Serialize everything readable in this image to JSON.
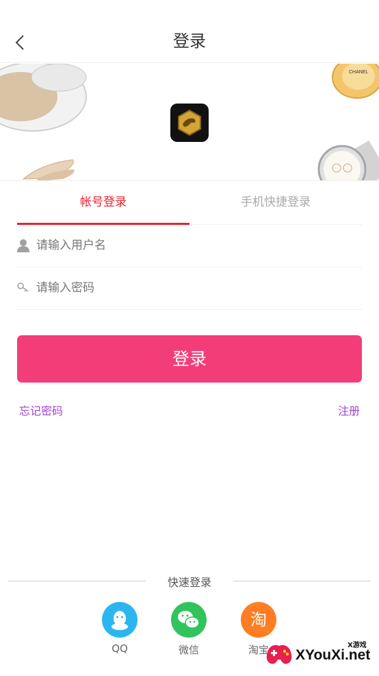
{
  "header": {
    "title": "登录"
  },
  "tabs": {
    "account": "帐号登录",
    "phone": "手机快捷登录"
  },
  "form": {
    "username_placeholder": "请输入用户名",
    "password_placeholder": "请输入密码",
    "login_label": "登录"
  },
  "links": {
    "forgot": "忘记密码",
    "register": "注册"
  },
  "quick_login": {
    "title": "快速登录",
    "options": [
      {
        "label": "QQ",
        "icon": "qq-icon"
      },
      {
        "label": "微信",
        "icon": "wechat-icon"
      },
      {
        "label": "淘宝",
        "icon": "taobao-icon",
        "glyph": "淘"
      }
    ]
  },
  "banner": {
    "brand_text": "CHANEL"
  },
  "watermark": {
    "text": "XYouXi.net",
    "sub": "X游戏"
  },
  "colors": {
    "accent": "#e8202f",
    "button": "#f33d78",
    "link": "#a143d4"
  }
}
